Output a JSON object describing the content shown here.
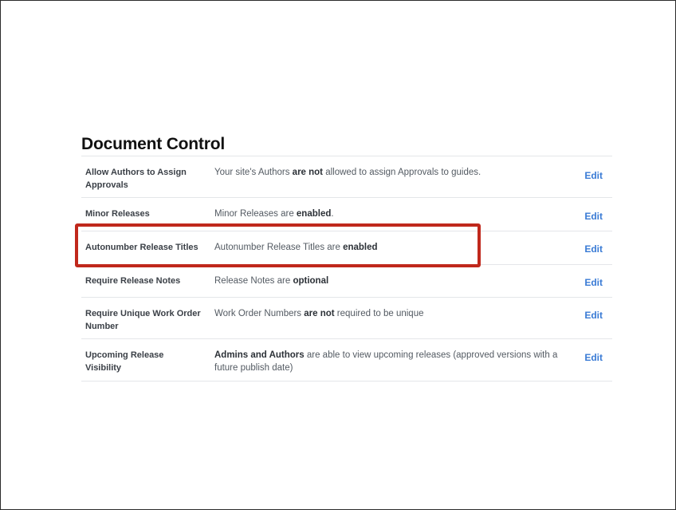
{
  "section": {
    "title": "Document Control"
  },
  "settings": [
    {
      "label": "Allow Authors to Assign Approvals",
      "desc": [
        {
          "text": "Your site's Authors ",
          "bold": false
        },
        {
          "text": "are not",
          "bold": true
        },
        {
          "text": " allowed to assign Approvals to guides.",
          "bold": false
        }
      ],
      "edit": "Edit"
    },
    {
      "label": "Minor Releases",
      "desc": [
        {
          "text": "Minor Releases are ",
          "bold": false
        },
        {
          "text": "enabled",
          "bold": true
        },
        {
          "text": ".",
          "bold": false
        }
      ],
      "edit": "Edit"
    },
    {
      "label": "Autonumber Release Titles",
      "desc": [
        {
          "text": "Autonumber Release Titles are ",
          "bold": false
        },
        {
          "text": "enabled",
          "bold": true
        }
      ],
      "edit": "Edit"
    },
    {
      "label": "Require Release Notes",
      "desc": [
        {
          "text": "Release Notes are ",
          "bold": false
        },
        {
          "text": "optional",
          "bold": true
        }
      ],
      "edit": "Edit"
    },
    {
      "label": "Require Unique Work Order Number",
      "desc": [
        {
          "text": "Work Order Numbers ",
          "bold": false
        },
        {
          "text": "are not",
          "bold": true
        },
        {
          "text": " required to be unique",
          "bold": false
        }
      ],
      "edit": "Edit"
    },
    {
      "label": "Upcoming Release Visibility",
      "desc": [
        {
          "text": "Admins and Authors",
          "bold": true
        },
        {
          "text": " are able to view upcoming releases (approved versions with a future publish date)",
          "bold": false
        }
      ],
      "edit": "Edit"
    }
  ],
  "colors": {
    "highlight": "#c0281c",
    "link": "#3a7bd5"
  }
}
